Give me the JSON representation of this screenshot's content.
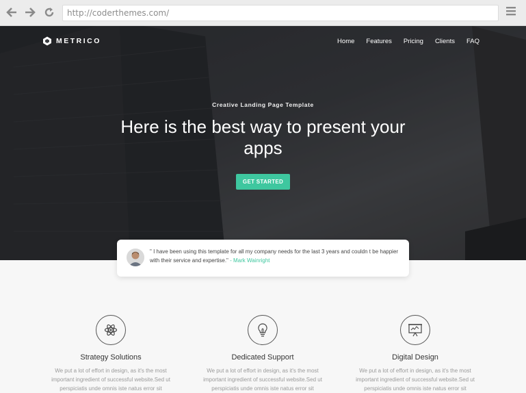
{
  "browser": {
    "url": "http://coderthemes.com/",
    "back_icon": "arrow-left-icon",
    "forward_icon": "arrow-right-icon",
    "reload_icon": "reload-icon",
    "menu_icon": "hamburger-menu-icon"
  },
  "header": {
    "brand": "METRICO",
    "nav": [
      "Home",
      "Features",
      "Pricing",
      "Clients",
      "FAQ"
    ]
  },
  "hero": {
    "tagline": "Creative Landing Page Template",
    "headline": "Here is the best way to present your apps",
    "cta": "GET STARTED"
  },
  "testimonial": {
    "quote": "\" I have been using this template for all my company needs for the last 3 years and couldn t be happier with their service and expertise.\"",
    "author": "- Mark Wainright"
  },
  "features": [
    {
      "icon": "atom-icon",
      "title": "Strategy Solutions",
      "desc": "We put a lot of effort in design, as it's the most important ingredient of successful website.Sed ut perspiciatis unde omnis iste natus error sit"
    },
    {
      "icon": "lightbulb-icon",
      "title": "Dedicated Support",
      "desc": "We put a lot of effort in design, as it's the most important ingredient of successful website.Sed ut perspiciatis unde omnis iste natus error sit"
    },
    {
      "icon": "presentation-icon",
      "title": "Digital Design",
      "desc": "We put a lot of effort in design, as it's the most important ingredient of successful website.Sed ut perspiciatis unde omnis iste natus error sit"
    }
  ],
  "colors": {
    "accent": "#3ec79f",
    "hero_dark": "#2f3135",
    "page_bg": "#f7f7f7"
  }
}
